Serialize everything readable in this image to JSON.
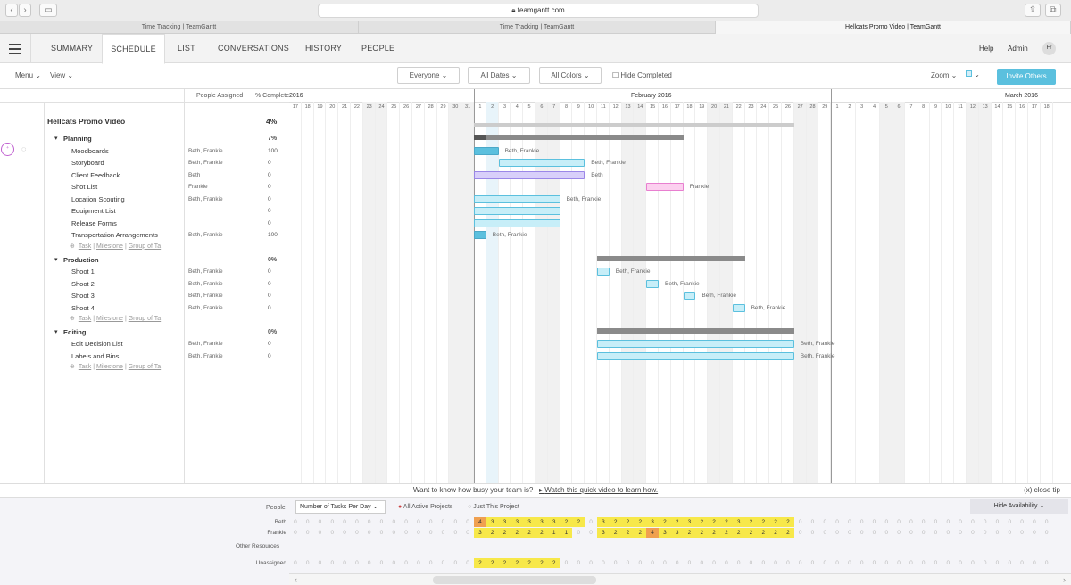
{
  "browser": {
    "url": "teamgantt.com",
    "tabs": [
      "Time Tracking | TeamGantt",
      "Time Tracking | TeamGantt",
      "Hellcats Promo Video | TeamGantt"
    ]
  },
  "nav": {
    "tabs": [
      "SUMMARY",
      "SCHEDULE",
      "LIST",
      "CONVERSATIONS",
      "HISTORY",
      "PEOPLE"
    ],
    "active": "SCHEDULE",
    "help": "Help",
    "admin": "Admin",
    "avatar": "Fr"
  },
  "toolbar": {
    "menu": "Menu",
    "view": "View",
    "everyone": "Everyone",
    "dates": "All Dates",
    "colors": "All Colors",
    "hide_completed": "Hide Completed",
    "zoom": "Zoom",
    "invite": "Invite Others"
  },
  "grid_header": {
    "people": "People Assigned",
    "pct": "% Complete",
    "year": "2016",
    "feb": "February 2016",
    "mar": "March 2016"
  },
  "project": {
    "name": "Hellcats Promo Video",
    "pct": "4%"
  },
  "add_links": {
    "task": "Task",
    "milestone": "Milestone",
    "group": "Group of Ta"
  },
  "groups": [
    {
      "name": "Planning",
      "pct": "7%",
      "tasks": [
        {
          "name": "Moodboards",
          "people": "Beth, Frankie",
          "pct": "100"
        },
        {
          "name": "Storyboard",
          "people": "Beth, Frankie",
          "pct": "0"
        },
        {
          "name": "Client Feedback",
          "people": "Beth",
          "pct": "0"
        },
        {
          "name": "Shot List",
          "people": "Frankie",
          "pct": "0"
        },
        {
          "name": "Location Scouting",
          "people": "Beth, Frankie",
          "pct": "0"
        },
        {
          "name": "Equipment List",
          "people": "",
          "pct": "0"
        },
        {
          "name": "Release Forms",
          "people": "",
          "pct": "0"
        },
        {
          "name": "Transportation Arrangements",
          "people": "Beth, Frankie",
          "pct": "100"
        }
      ]
    },
    {
      "name": "Production",
      "pct": "0%",
      "tasks": [
        {
          "name": "Shoot 1",
          "people": "Beth, Frankie",
          "pct": "0"
        },
        {
          "name": "Shoot 2",
          "people": "Beth, Frankie",
          "pct": "0"
        },
        {
          "name": "Shoot 3",
          "people": "Beth, Frankie",
          "pct": "0"
        },
        {
          "name": "Shoot 4",
          "people": "Beth, Frankie",
          "pct": "0"
        }
      ]
    },
    {
      "name": "Editing",
      "pct": "0%",
      "tasks": [
        {
          "name": "Edit Decision List",
          "people": "Beth, Frankie",
          "pct": "0"
        },
        {
          "name": "Labels and Bins",
          "people": "Beth, Frankie",
          "pct": "0"
        }
      ]
    }
  ],
  "days": [
    "17",
    "18",
    "19",
    "20",
    "21",
    "22",
    "23",
    "24",
    "25",
    "26",
    "27",
    "28",
    "29",
    "30",
    "31",
    "1",
    "2",
    "3",
    "4",
    "5",
    "6",
    "7",
    "8",
    "9",
    "10",
    "11",
    "12",
    "13",
    "14",
    "15",
    "16",
    "17",
    "18",
    "19",
    "20",
    "21",
    "22",
    "23",
    "24",
    "25",
    "26",
    "27",
    "28",
    "29",
    "1",
    "2",
    "3",
    "4",
    "5",
    "6",
    "7",
    "8",
    "9",
    "10",
    "11",
    "12",
    "13",
    "14",
    "15",
    "16",
    "17",
    "18"
  ],
  "tip": {
    "text": "Want to know how busy your team is?",
    "link": "Watch this quick video to learn how.",
    "close": "(x) close tip"
  },
  "availability": {
    "people": "People",
    "metric": "Number of Tasks Per Day",
    "all": "All Active Projects",
    "just": "Just This Project",
    "hide": "Hide Availability",
    "other": "Other Resources",
    "rows": [
      {
        "name": "Beth",
        "vals": [
          "0",
          "0",
          "0",
          "0",
          "0",
          "0",
          "0",
          "0",
          "0",
          "0",
          "0",
          "0",
          "0",
          "0",
          "0",
          "4",
          "3",
          "3",
          "3",
          "3",
          "3",
          "3",
          "2",
          "2",
          "0",
          "3",
          "2",
          "2",
          "2",
          "3",
          "2",
          "2",
          "3",
          "2",
          "2",
          "2",
          "3",
          "2",
          "2",
          "2",
          "2",
          "0",
          "0",
          "0",
          "0",
          "0",
          "0",
          "0",
          "0",
          "0",
          "0",
          "0",
          "0",
          "0",
          "0",
          "0",
          "0",
          "0",
          "0",
          "0",
          "0",
          "0"
        ]
      },
      {
        "name": "Frankie",
        "vals": [
          "0",
          "0",
          "0",
          "0",
          "0",
          "0",
          "0",
          "0",
          "0",
          "0",
          "0",
          "0",
          "0",
          "0",
          "0",
          "3",
          "2",
          "2",
          "2",
          "2",
          "2",
          "1",
          "1",
          "0",
          "0",
          "3",
          "2",
          "2",
          "2",
          "4",
          "3",
          "3",
          "2",
          "2",
          "2",
          "2",
          "2",
          "2",
          "2",
          "2",
          "2",
          "0",
          "0",
          "0",
          "0",
          "0",
          "0",
          "0",
          "0",
          "0",
          "0",
          "0",
          "0",
          "0",
          "0",
          "0",
          "0",
          "0",
          "0",
          "0",
          "0",
          "0"
        ]
      },
      {
        "name": "Unassigned",
        "vals": [
          "0",
          "0",
          "0",
          "0",
          "0",
          "0",
          "0",
          "0",
          "0",
          "0",
          "0",
          "0",
          "0",
          "0",
          "0",
          "2",
          "2",
          "2",
          "2",
          "2",
          "2",
          "2",
          "0",
          "0",
          "0",
          "0",
          "0",
          "0",
          "0",
          "0",
          "0",
          "0",
          "0",
          "0",
          "0",
          "0",
          "0",
          "0",
          "0",
          "0",
          "0",
          "0",
          "0",
          "0",
          "0",
          "0",
          "0",
          "0",
          "0",
          "0",
          "0",
          "0",
          "0",
          "0",
          "0",
          "0",
          "0",
          "0",
          "0",
          "0",
          "0",
          "0"
        ]
      }
    ]
  }
}
